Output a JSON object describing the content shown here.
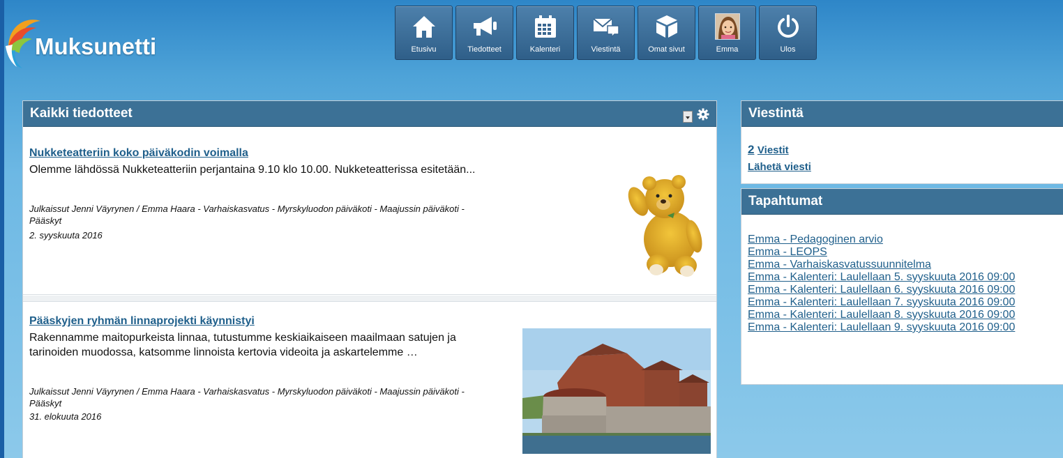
{
  "app": {
    "name": "Muksunetti"
  },
  "nav": [
    {
      "label": "Etusivu",
      "icon": "home-icon"
    },
    {
      "label": "Tiedotteet",
      "icon": "megaphone-icon"
    },
    {
      "label": "Kalenteri",
      "icon": "calendar-icon"
    },
    {
      "label": "Viestintä",
      "icon": "envelope-icon"
    },
    {
      "label": "Omat sivut",
      "icon": "cube-icon"
    },
    {
      "label": "Emma",
      "icon": "avatar"
    },
    {
      "label": "Ulos",
      "icon": "power-icon"
    }
  ],
  "main": {
    "title": "Kaikki tiedotteet",
    "articles": [
      {
        "title": "Nukketeatteriin koko päiväkodin voimalla",
        "body": "Olemme lähdössä Nukketeatteriin perjantaina 9.10 klo 10.00. Nukketeatterissa esitetään...",
        "meta": "Julkaissut Jenni Väyrynen / Emma Haara - Varhaiskasvatus - Myrskyluodon päiväkoti - Maajussin päiväkoti - Pääskyt",
        "date": "2. syyskuuta 2016",
        "image": "teddy-bear"
      },
      {
        "title": "Pääskyjen ryhmän linnaprojekti käynnistyi",
        "body": "Rakennamme maitopurkeista linnaa, tutustumme keskiaikaiseen maailmaan satujen ja tarinoiden muodossa, katsomme linnoista kertovia videoita ja askartelemme …",
        "meta": "Julkaissut Jenni Väyrynen / Emma Haara - Varhaiskasvatus - Myrskyluodon päiväkoti - Maajussin päiväkoti - Pääskyt",
        "date": "31. elokuuta 2016",
        "image": "castle"
      }
    ]
  },
  "viestinta": {
    "title": "Viestintä",
    "count": "2",
    "messages_label": "Viestit",
    "send_label": "Lähetä viesti"
  },
  "tapahtumat": {
    "title": "Tapahtumat",
    "items": [
      "Emma - Pedagoginen arvio",
      "Emma - LEOPS",
      "Emma - Varhaiskasvatussuunnitelma",
      "Emma - Kalenteri: Laulellaan 5. syyskuuta 2016 09:00",
      "Emma - Kalenteri: Laulellaan 6. syyskuuta 2016 09:00",
      "Emma - Kalenteri: Laulellaan 7. syyskuuta 2016 09:00",
      "Emma - Kalenteri: Laulellaan 8. syyskuuta 2016 09:00",
      "Emma - Kalenteri: Laulellaan 9. syyskuuta 2016 09:00"
    ]
  }
}
